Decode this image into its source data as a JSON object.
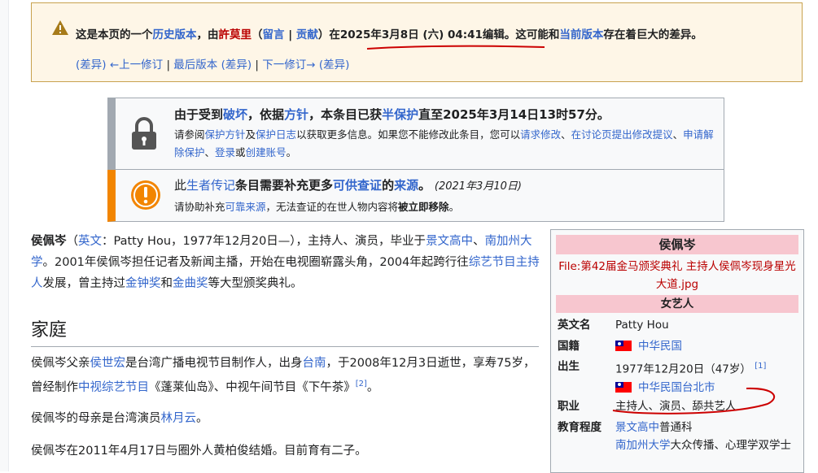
{
  "revision_banner": {
    "line1": {
      "p1": "这是本页的一个",
      "history_link": "历史版本",
      "p2": "，由",
      "user_link": "許莫里",
      "p3": "（",
      "talk_link": "留言",
      "sep": " | ",
      "contrib_link": "贡献",
      "p4": "）",
      "date_text": "在2025年3月8日 (六) 04:41编辑",
      "p5": "。这可能和",
      "current_link": "当前版本",
      "p6": "存在着巨大的差异。"
    },
    "line2": {
      "diff1": "(差异)",
      "prev_link": "←上一修订",
      "sep1": " | ",
      "latest_link": "最后版本",
      "diff2": "(差异)",
      "sep2": " | ",
      "next_link": "下一修订→",
      "diff3": "(差异)"
    },
    "warning_color": "#fef6e7"
  },
  "protection_notice": {
    "icon": "lock-icon",
    "t1": "由于受到",
    "vandalism_link": "破坏",
    "t2": "，依据",
    "policy_link": "方针",
    "t3": "，本条目已获",
    "semi_link": "半保护",
    "t4": "直至2025年3月14日13时57分。",
    "s1": "请参阅",
    "s_policy": "保护方针",
    "s2": "及",
    "s_log": "保护日志",
    "s3": "以获取更多信息。如果您不能修改此条目，您可以",
    "s_request": "请求修改",
    "s4": "、",
    "s_talk": "在讨论页提出修改提议",
    "s5": "、",
    "s_unprotect": "申请解除保护",
    "s6": "、",
    "s_login": "登录",
    "s7": "或",
    "s_create": "创建账号",
    "s8": "。"
  },
  "citation_notice": {
    "icon": "exclamation-icon",
    "t1": "此",
    "blp_link": "生者传记",
    "t2": "条目需要补充更多",
    "verifiable_link": "可供查证",
    "t3": "的",
    "source_link": "来源",
    "t4": "。",
    "date": "(2021年3月10日)",
    "s1": "请协助补充",
    "s_reliable": "可靠来源",
    "s2": "，无法查证的在世人物内容将",
    "s_bold": "被立即移除",
    "s3": "。"
  },
  "article": {
    "intro": {
      "name": "侯佩岑",
      "p1": "（",
      "lang_link": "英文",
      "p2": "：Patty Hou，1977年12月20日—），主持人、演员，毕业于",
      "school_link": "景文高中",
      "p3": "、",
      "usc_link": "南加州大学",
      "p4": "。2001年侯佩岑担任记者及新闻主播，开始在电视圈崭露头角，2004年起跨行往",
      "variety_link": "综艺节目主持人",
      "p5": "发展，曾主持过",
      "golden_bell_link": "金钟奖",
      "p6": "和",
      "golden_melody_link": "金曲奖",
      "p7": "等大型颁奖典礼。"
    },
    "family_heading": "家庭",
    "family_p1": {
      "p1": "侯佩岑父亲",
      "father_link": "侯世宏",
      "p2": "是台湾广播电视节目制作人，出身",
      "tainan_link": "台南",
      "p3": "，于2008年12月3日逝世，享寿75岁，曾经制作",
      "ctv_link": "中视综艺节目",
      "p4": "《蓬莱仙岛》、中视午间节目《下午茶》",
      "ref": "[2]",
      "p5": "。"
    },
    "family_p2": {
      "p1": "侯佩岑的母亲是台湾演员",
      "mother_link": "林月云",
      "p2": "。"
    },
    "family_p3": "侯佩岑在2011年4月17日与圈外人黄柏俊结婚。目前育有二子。"
  },
  "infobox": {
    "title": "侯佩岑",
    "image_caption": "File:第42届金马颁奖典礼 主持人侯佩岑现身星光大道.jpg",
    "section": "女艺人",
    "rows": [
      {
        "label": "英文名",
        "value": "Patty Hou"
      },
      {
        "label": "国籍",
        "value": "中华民国"
      },
      {
        "label": "出生",
        "value": "1977年12月20日（47岁）",
        "ref": "[1]",
        "place": "中华民国台北市"
      },
      {
        "label": "职业",
        "value": "主持人、演员、舔共艺人"
      },
      {
        "label": "教育程度",
        "school1": "景文高中",
        "school1_suffix": "普通科",
        "school2": "南加州大学",
        "school2_suffix": "大众传播、心理学双学士"
      }
    ],
    "header_color": "#f7c6cf"
  }
}
